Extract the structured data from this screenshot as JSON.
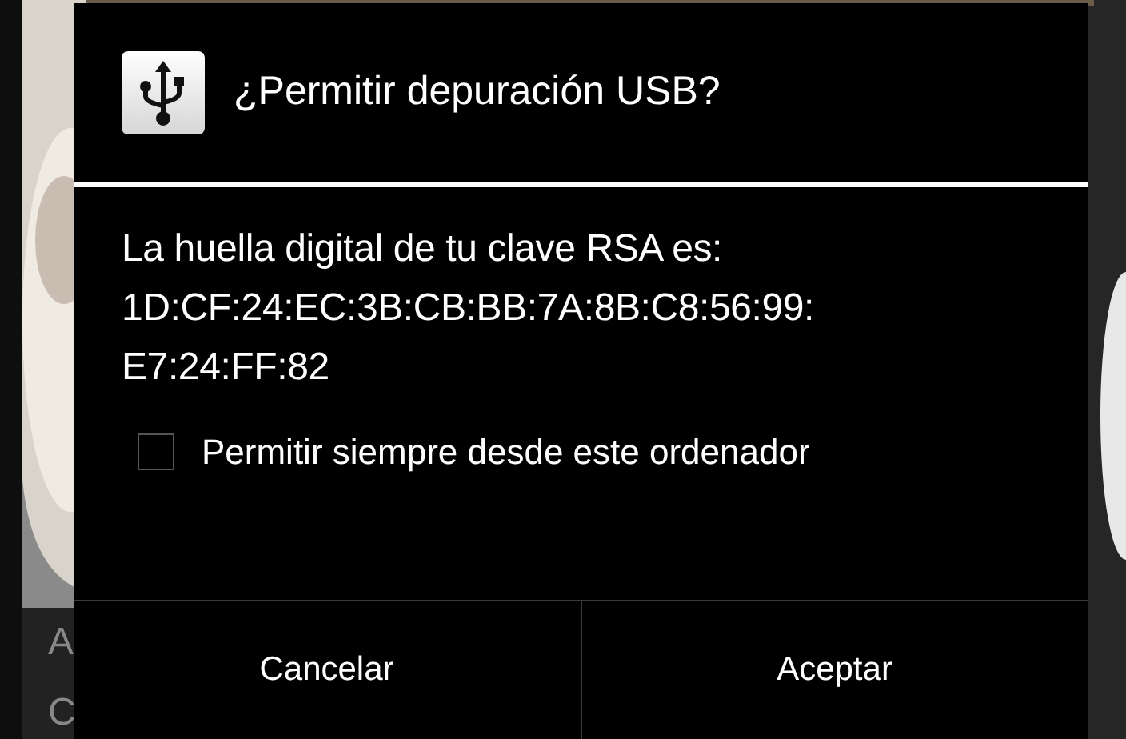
{
  "background": {
    "kind": "picture",
    "texts": [
      "A",
      "C"
    ]
  },
  "dialog": {
    "title": "¿Permitir depuración USB?",
    "message": [
      "La huella digital de tu clave RSA es:",
      "1D:CF:24:EC:3B:CB:BB:7A:8B:C8:56:99:",
      "E7:24:FF:82"
    ],
    "checkbox": {
      "label": "Permitir siempre desde este ordenador",
      "checked": false
    },
    "buttons": [
      "Cancelar",
      "Aceptar"
    ]
  }
}
